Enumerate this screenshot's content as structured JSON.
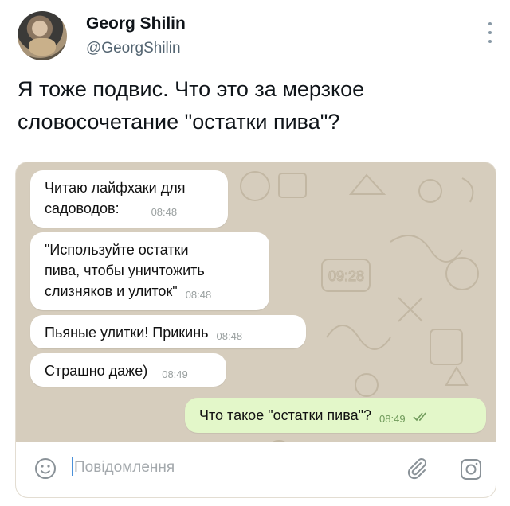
{
  "tweet": {
    "display_name": "Georg Shilin",
    "handle": "@GeorgShilin",
    "text_line1": "Я тоже подвис. Что это за мерзкое",
    "text_line2": "словосочетание \"остатки пива\"?"
  },
  "chat": {
    "messages": [
      {
        "line1": "Читаю лайфхаки для",
        "line2": "садоводов:",
        "time": "08:48",
        "direction": "in"
      },
      {
        "line1": "\"Используйте остатки",
        "line2": "пива, чтобы уничтожить",
        "line3": "слизняков и улиток\"",
        "time": "08:48",
        "direction": "in"
      },
      {
        "line1": "Пьяные улитки! Прикинь",
        "time": "08:48",
        "direction": "in"
      },
      {
        "line1": "Страшно даже)",
        "time": "08:49",
        "direction": "in"
      },
      {
        "line1": "Что такое \"остатки пива\"?",
        "time": "08:49",
        "direction": "out",
        "status": "read"
      }
    ],
    "wallpaper_clock": "09:28",
    "composer": {
      "placeholder": "Повідомлення",
      "emoji_icon": "emoji-icon",
      "attach_icon": "paperclip-icon",
      "camera_icon": "camera-icon"
    }
  },
  "colors": {
    "outgoing_bubble": "#e3f7c9",
    "wallpaper": "#d8d0c0",
    "read_checks": "#6f9a5a"
  }
}
